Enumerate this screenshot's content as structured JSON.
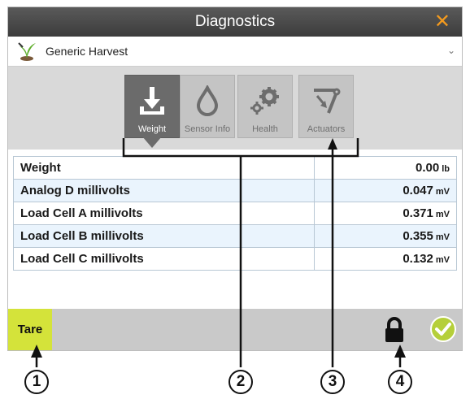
{
  "window": {
    "title": "Diagnostics"
  },
  "profile": {
    "label": "Generic Harvest"
  },
  "tabs": [
    {
      "label": "Weight",
      "icon": "download-tray-icon",
      "active": true
    },
    {
      "label": "Sensor Info",
      "icon": "droplet-icon",
      "active": false
    },
    {
      "label": "Health",
      "icon": "gears-icon",
      "active": false
    },
    {
      "label": "Actuators",
      "icon": "actuator-icon",
      "active": false
    }
  ],
  "table": {
    "rows": [
      {
        "name": "Weight",
        "value": "0.00",
        "unit": "lb"
      },
      {
        "name": "Analog D millivolts",
        "value": "0.047",
        "unit": "mV"
      },
      {
        "name": "Load Cell A millivolts",
        "value": "0.371",
        "unit": "mV"
      },
      {
        "name": "Load Cell B millivolts",
        "value": "0.355",
        "unit": "mV"
      },
      {
        "name": "Load Cell C millivolts",
        "value": "0.132",
        "unit": "mV"
      }
    ]
  },
  "footer": {
    "tare_label": "Tare"
  },
  "callouts": [
    "1",
    "2",
    "3",
    "4"
  ],
  "colors": {
    "accent_orange": "#f39a1e",
    "tare_yellow": "#d4e33a",
    "check_green": "#b5cf3a"
  }
}
